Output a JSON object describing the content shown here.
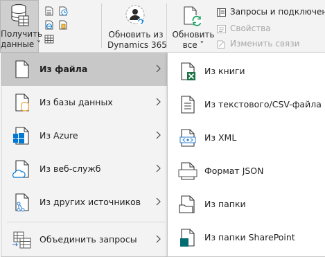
{
  "ribbon": {
    "get_data": {
      "line1": "Получить",
      "line2": "данные ˅"
    },
    "dynamics": {
      "line1": "Обновить из",
      "line2": "Dynamics 365"
    },
    "refresh_all": {
      "line1": "Обновить",
      "line2": "все ˅"
    },
    "queries_group": {
      "queries_connections": "Запросы и подключения",
      "properties": "Свойства",
      "edit_links": "Изменить связи"
    }
  },
  "menu": {
    "items": [
      {
        "label": "Из файла",
        "icon": "file-icon"
      },
      {
        "label": "Из базы данных",
        "icon": "database-icon"
      },
      {
        "label": "Из Azure",
        "icon": "azure-icon"
      },
      {
        "label": "Из веб-служб",
        "icon": "cloud-icon"
      },
      {
        "label": "Из других источников",
        "icon": "other-sources-icon"
      },
      {
        "label": "Объединить запросы",
        "icon": "combine-queries-icon"
      }
    ]
  },
  "submenu": {
    "items": [
      {
        "label": "Из книги",
        "icon": "excel-workbook-icon"
      },
      {
        "label": "Из текстового/CSV-файла",
        "icon": "text-csv-icon"
      },
      {
        "label": "Из XML",
        "icon": "xml-icon"
      },
      {
        "label": "Формат JSON",
        "icon": "json-icon"
      },
      {
        "label": "Из папки",
        "icon": "folder-icon"
      },
      {
        "label": "Из папки SharePoint",
        "icon": "sharepoint-folder-icon"
      }
    ]
  },
  "colors": {
    "excel_green": "#1e7145",
    "sharepoint_teal": "#036c70",
    "azure_blue": "#0078d4",
    "database_orange": "#e8a33b",
    "menu_bg": "#f3f3f3",
    "selected_bg": "#c8c8c8"
  }
}
